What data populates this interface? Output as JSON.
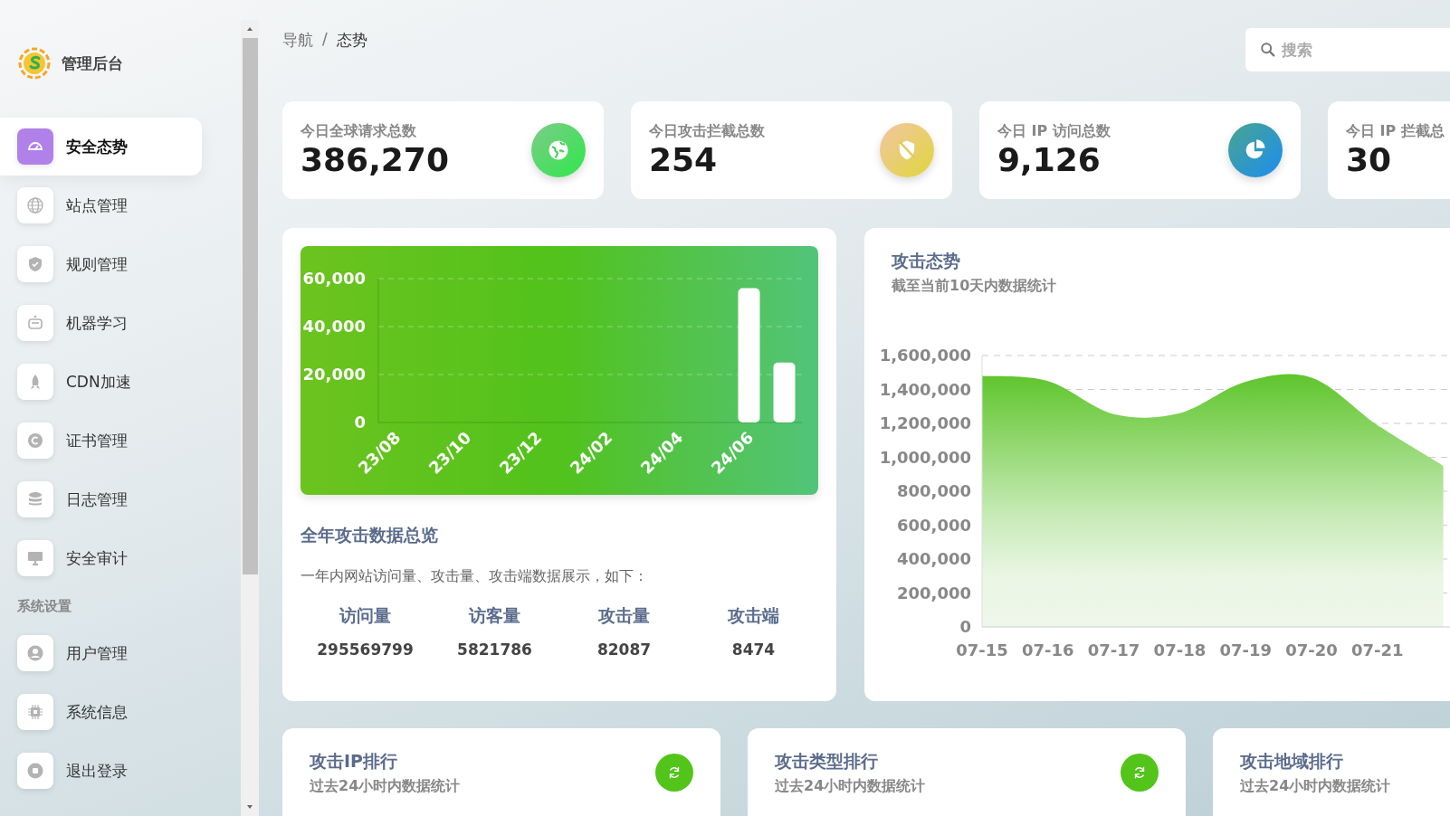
{
  "sidebar": {
    "logo": {
      "title": "管理后台"
    },
    "items": [
      {
        "label": "安全态势",
        "selected": true
      },
      {
        "label": "站点管理",
        "selected": false
      },
      {
        "label": "规则管理",
        "selected": false
      },
      {
        "label": "机器学习",
        "selected": false
      },
      {
        "label": "CDN加速",
        "selected": false
      },
      {
        "label": "证书管理",
        "selected": false
      },
      {
        "label": "日志管理",
        "selected": false
      },
      {
        "label": "安全审计",
        "selected": false
      }
    ],
    "section": {
      "title": "系统设置",
      "items": [
        {
          "label": "用户管理",
          "selected": false
        },
        {
          "label": "系统信息",
          "selected": false
        },
        {
          "label": "退出登录",
          "selected": false
        }
      ]
    }
  },
  "breadcrumb": {
    "items": [
      "导航",
      "态势"
    ],
    "separator": "/"
  },
  "search": {
    "placeholder": "搜索"
  },
  "stats": [
    {
      "label": "今日全球请求总数",
      "value": "386,270"
    },
    {
      "label": "今日攻击拦截总数",
      "value": "254"
    },
    {
      "label": "今日 IP 访问总数",
      "value": "9,126"
    },
    {
      "label": "今日 IP 拦截总",
      "value": "30"
    }
  ],
  "yearly": {
    "chart_data": {
      "type": "bar",
      "categories": [
        "23/08",
        null,
        "23/10",
        null,
        "23/12",
        null,
        "24/02",
        null,
        "24/04",
        null,
        "24/06",
        null
      ],
      "values": [
        null,
        null,
        null,
        null,
        null,
        null,
        null,
        null,
        null,
        null,
        56000,
        25000
      ],
      "ylim": [
        0,
        60000
      ],
      "grid": true,
      "yticks": [
        {
          "value": 0,
          "label": "0"
        },
        {
          "value": 20000,
          "label": "20,000"
        },
        {
          "value": 40000,
          "label": "40,000"
        },
        {
          "value": 60000,
          "label": "60,000"
        }
      ]
    },
    "title": "全年攻击数据总览",
    "description": "一年内网站访问量、攻击量、攻击端数据展示，如下：",
    "metrics": [
      {
        "label": "访问量",
        "value": "295569799"
      },
      {
        "label": "访客量",
        "value": "5821786"
      },
      {
        "label": "攻击量",
        "value": "82087"
      },
      {
        "label": "攻击端",
        "value": "8474"
      }
    ]
  },
  "trend": {
    "title": "攻击态势",
    "subtitle": "截至当前10天内数据统计",
    "chart_data": {
      "type": "area",
      "categories": [
        "07-15",
        "07-16",
        "07-17",
        "07-18",
        "07-19",
        "07-20",
        "07-21",
        null
      ],
      "values": [
        1480000,
        1450000,
        1255000,
        1260000,
        1445000,
        1470000,
        1190000,
        950000
      ],
      "ylim": [
        0,
        1600000
      ],
      "grid": true,
      "yticks": [
        {
          "value": 0,
          "label": "0"
        },
        {
          "value": 200000,
          "label": "200,000"
        },
        {
          "value": 400000,
          "label": "400,000"
        },
        {
          "value": 600000,
          "label": "600,000"
        },
        {
          "value": 800000,
          "label": "800,000"
        },
        {
          "value": 1000000,
          "label": "1,000,000"
        },
        {
          "value": 1200000,
          "label": "1,200,000"
        },
        {
          "value": 1400000,
          "label": "1,400,000"
        },
        {
          "value": 1600000,
          "label": "1,600,000"
        }
      ]
    }
  },
  "rankings": [
    {
      "title": "攻击IP排行",
      "subtitle": "过去24小时内数据统计",
      "refresh": true
    },
    {
      "title": "攻击类型排行",
      "subtitle": "过去24小时内数据统计",
      "refresh": true
    },
    {
      "title": "攻击地域排行",
      "subtitle": "过去24小时内数据统计",
      "refresh": false
    }
  ]
}
